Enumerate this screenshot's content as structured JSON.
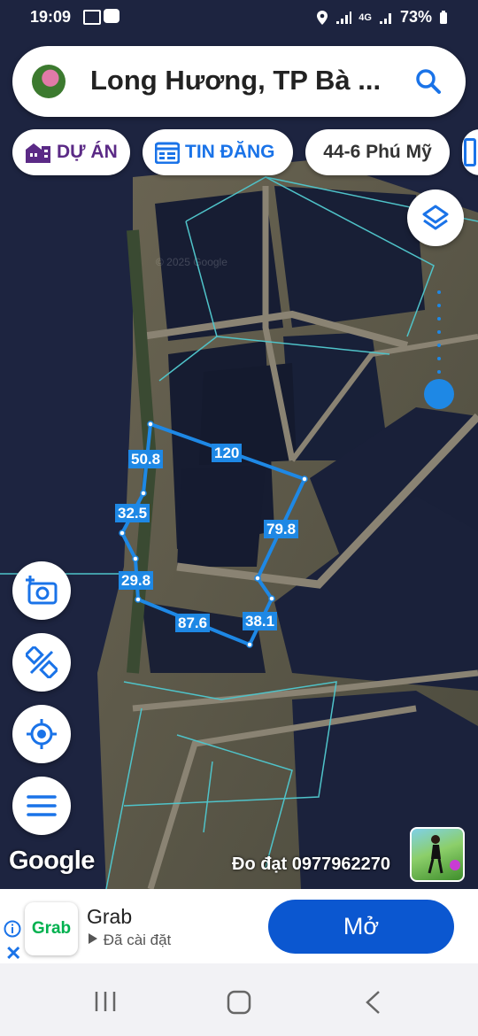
{
  "status_bar": {
    "time": "19:09",
    "network": "4G",
    "battery": "73%"
  },
  "search": {
    "title": "Long Hương, TP Bà ...",
    "search_icon": "search-icon"
  },
  "chips": [
    {
      "label": "DỰ ÁN",
      "icon": "building-icon"
    },
    {
      "label": "TIN ĐĂNG",
      "icon": "listing-icon"
    },
    {
      "label": "44-6 Phú Mỹ"
    }
  ],
  "map": {
    "segment_labels": [
      "120",
      "50.8",
      "32.5",
      "79.8",
      "29.8",
      "87.6",
      "38.1"
    ],
    "google_logo": "Google",
    "owner_label": "Đo đạt 0977962270",
    "watermark": "© 2025 Google"
  },
  "buttons": {
    "layers": "layers-icon",
    "camera": "camera-add-icon",
    "measure": "ruler-icon",
    "locate": "gps-icon",
    "menu": "menu-icon"
  },
  "ad": {
    "brand_logo": "Grab",
    "name": "Grab",
    "subtitle": "Đã cài đặt",
    "action_label": "Mở"
  },
  "colors": {
    "accent_blue": "#1e88e5",
    "chip_purple": "#5b2a86",
    "ad_button": "#0b57d0",
    "parcel_line": "#4fc3c9"
  }
}
